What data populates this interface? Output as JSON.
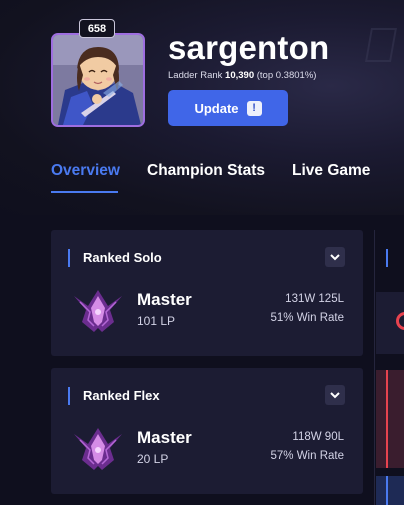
{
  "profile": {
    "level": "658",
    "name": "sargenton",
    "ladder_label": "Ladder Rank",
    "ladder_rank": "10,390",
    "ladder_top": "(top 0.3801%)",
    "update_label": "Update",
    "update_alert": "!"
  },
  "tabs": [
    {
      "label": "Overview",
      "active": true
    },
    {
      "label": "Champion Stats",
      "active": false
    },
    {
      "label": "Live Game",
      "active": false
    }
  ],
  "ranked": [
    {
      "queue": "Ranked Solo",
      "tier": "Master",
      "lp": "101 LP",
      "record": "131W 125L",
      "win_rate": "51% Win Rate"
    },
    {
      "queue": "Ranked Flex",
      "tier": "Master",
      "lp": "20 LP",
      "record": "118W 90L",
      "win_rate": "57% Win Rate"
    }
  ],
  "icons": {
    "chevron": "chevron-down-icon",
    "emblem": "master-rank-emblem-icon",
    "alert": "exclamation-icon"
  },
  "colors": {
    "accent": "#4a7af0",
    "update_button": "#4066e8",
    "card_bg": "#1c1c33",
    "page_bg": "#0f0f1e",
    "avatar_border": "#9e6ee0",
    "master_emblem": "#a25bd0"
  }
}
